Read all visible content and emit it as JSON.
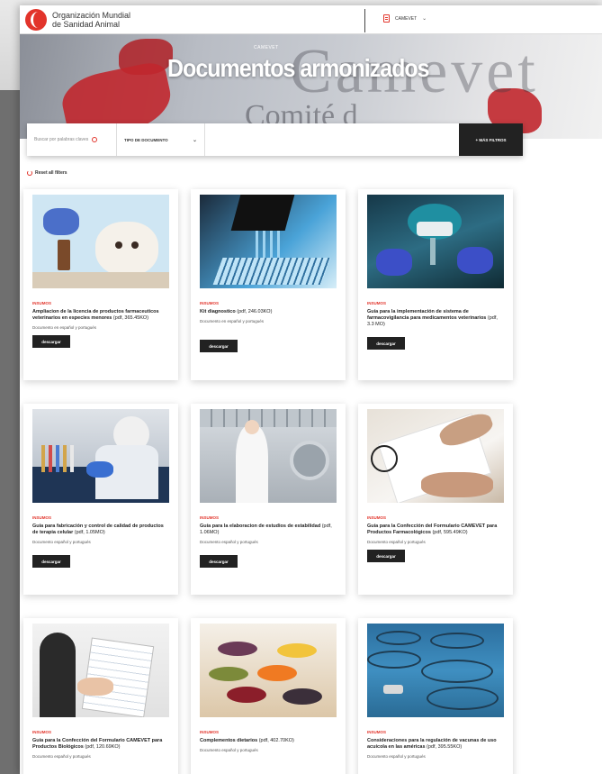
{
  "header": {
    "org_line1": "Organización Mundial",
    "org_line2": "de Sanidad Animal",
    "site_selector": "CAMEVET"
  },
  "hero": {
    "overline": "CAMEVET",
    "title": "Documentos armonizados",
    "bg_word": "Camevet",
    "bg_subword": "Comité d"
  },
  "search": {
    "placeholder": "Buscar por palabras claves",
    "type_filter": "TIPO DE DOCUMENTO",
    "more_button": "+ MÁS FILTROS",
    "reset_filters": "Reset all filters"
  },
  "colors": {
    "accent": "#e2342b",
    "button_dark": "#222222"
  },
  "cards": [
    {
      "tag": "INSUMOS",
      "title": "Ampliacion de la licencia de productos farmaceuticos veterinarios en especies menores",
      "size": "(pdf, 365.45KO)",
      "lang": "Documento en español y portugués",
      "button": "descargar",
      "image": "vet-dog"
    },
    {
      "tag": "INSUMOS",
      "title": "Kit diagnostico",
      "size": "(pdf, 246.03KO)",
      "lang": "Documento en español y portugués",
      "button": "descargar",
      "image": "lab-pipette"
    },
    {
      "tag": "INSUMOS",
      "title": "Guía para la implementación de sistema de farmacovigilancia para medicamentos veterinarios",
      "size": "(pdf, 3.3 MO)",
      "lang": "",
      "button": "descargar",
      "image": "lab-microscope"
    },
    {
      "tag": "INSUMOS",
      "title": "Guía para fabricación y control de calidad de productos de terapia celular",
      "size": "(pdf, 1.05MO)",
      "lang": "Documento español y portugués",
      "button": "descargar",
      "image": "lab-tubes"
    },
    {
      "tag": "INSUMOS",
      "title": "Guía para la elaboracion de estudios de estabilidad",
      "size": "(pdf, 1.06MO)",
      "lang": "Documento español y portugués",
      "button": "descargar",
      "image": "factory"
    },
    {
      "tag": "INSUMOS",
      "title": "Guía para la Confección del Formulario CAMEVET para Productos Farmacológicos",
      "size": "(pdf, 595.49KO)",
      "lang": "Documento español y portugués",
      "button": "descargar",
      "image": "writing"
    },
    {
      "tag": "INSUMOS",
      "title": "Guía para la Confección del Formulario CAMEVET para Productos Biológicos",
      "size": "(pdf, 120.69KO)",
      "lang": "Documento español y portugués",
      "button": "descargar",
      "image": "notepad"
    },
    {
      "tag": "INSUMOS",
      "title": "Complementos dietarios",
      "size": "(pdf, 402.70KO)",
      "lang": "Documento español y portugués",
      "button": "descargar",
      "image": "supplements"
    },
    {
      "tag": "INSUMOS",
      "title": "Consideraciones para la regulación de vacunas de uso acuícola en las américas",
      "size": "(pdf, 395.55KO)",
      "lang": "Documento español y portugués",
      "button": "descargar",
      "image": "fish-farm"
    }
  ]
}
